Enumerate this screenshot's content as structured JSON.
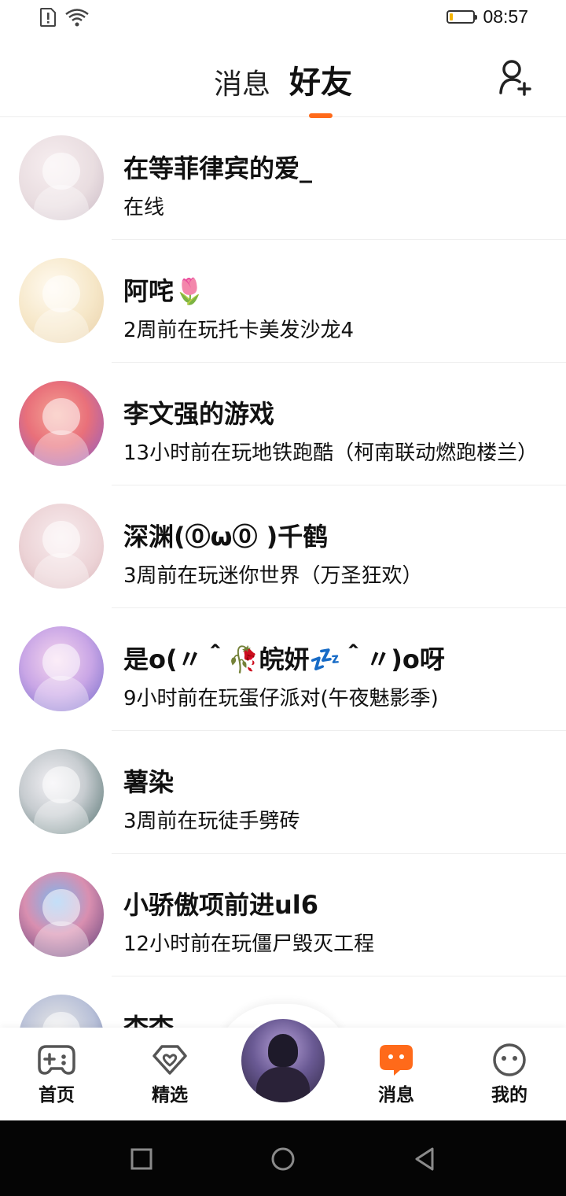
{
  "status_bar": {
    "time": "08:57",
    "battery_level": 0.15,
    "icons": [
      "alert-icon",
      "wifi-icon",
      "battery-icon"
    ]
  },
  "header": {
    "tabs": [
      {
        "label": "消息",
        "active": false
      },
      {
        "label": "好友",
        "active": true
      }
    ],
    "accent_color": "#ff6a1a",
    "add_friend_icon": "add-friend-icon"
  },
  "friends": [
    {
      "name": "在等菲律宾的爱_",
      "status": "在线",
      "avatar_color": "#e9dde0"
    },
    {
      "name": "阿咤🌷",
      "status": "2周前在玩托卡美发沙龙4",
      "avatar_color": "#f6e7c8"
    },
    {
      "name": "李文强的游戏",
      "status": "13小时前在玩地铁跑酷（柯南联动燃跑楼兰）",
      "avatar_color": "#f08a7a"
    },
    {
      "name": "深渊(⓪ω⓪ )千鹤",
      "status": "3周前在玩迷你世界（万圣狂欢）",
      "avatar_color": "#ecd3d6"
    },
    {
      "name": "是o(〃＾🥀皖妍💤＾〃)o呀",
      "status": "9小时前在玩蛋仔派对(午夜魅影季)",
      "avatar_color": "#c9a6e6"
    },
    {
      "name": "薯染",
      "status": "3周前在玩徒手劈砖",
      "avatar_color": "#9fb3b0"
    },
    {
      "name": "小骄傲项前进ul6",
      "status": "12小时前在玩僵尸毁灭工程",
      "avatar_color": "#d98fb0"
    },
    {
      "name": "杳杳",
      "status": "",
      "avatar_color": "#b8c0d8"
    }
  ],
  "bottom_nav": [
    {
      "label": "首页",
      "icon": "gamepad-icon",
      "active": false
    },
    {
      "label": "精选",
      "icon": "heart-badge-icon",
      "active": false
    },
    {
      "label": "消息",
      "icon": "chat-bubble-icon",
      "active": true
    },
    {
      "label": "我的",
      "icon": "smiley-icon",
      "active": false
    }
  ],
  "system_nav": [
    "recent-apps-icon",
    "home-circle-icon",
    "back-triangle-icon"
  ]
}
